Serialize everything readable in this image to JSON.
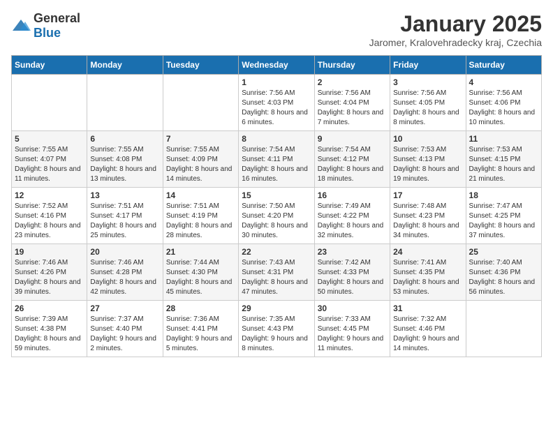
{
  "logo": {
    "general": "General",
    "blue": "Blue"
  },
  "title": "January 2025",
  "subtitle": "Jaromer, Kralovehradecky kraj, Czechia",
  "headers": [
    "Sunday",
    "Monday",
    "Tuesday",
    "Wednesday",
    "Thursday",
    "Friday",
    "Saturday"
  ],
  "weeks": [
    [
      {
        "day": "",
        "info": ""
      },
      {
        "day": "",
        "info": ""
      },
      {
        "day": "",
        "info": ""
      },
      {
        "day": "1",
        "info": "Sunrise: 7:56 AM\nSunset: 4:03 PM\nDaylight: 8 hours and 6 minutes."
      },
      {
        "day": "2",
        "info": "Sunrise: 7:56 AM\nSunset: 4:04 PM\nDaylight: 8 hours and 7 minutes."
      },
      {
        "day": "3",
        "info": "Sunrise: 7:56 AM\nSunset: 4:05 PM\nDaylight: 8 hours and 8 minutes."
      },
      {
        "day": "4",
        "info": "Sunrise: 7:56 AM\nSunset: 4:06 PM\nDaylight: 8 hours and 10 minutes."
      }
    ],
    [
      {
        "day": "5",
        "info": "Sunrise: 7:55 AM\nSunset: 4:07 PM\nDaylight: 8 hours and 11 minutes."
      },
      {
        "day": "6",
        "info": "Sunrise: 7:55 AM\nSunset: 4:08 PM\nDaylight: 8 hours and 13 minutes."
      },
      {
        "day": "7",
        "info": "Sunrise: 7:55 AM\nSunset: 4:09 PM\nDaylight: 8 hours and 14 minutes."
      },
      {
        "day": "8",
        "info": "Sunrise: 7:54 AM\nSunset: 4:11 PM\nDaylight: 8 hours and 16 minutes."
      },
      {
        "day": "9",
        "info": "Sunrise: 7:54 AM\nSunset: 4:12 PM\nDaylight: 8 hours and 18 minutes."
      },
      {
        "day": "10",
        "info": "Sunrise: 7:53 AM\nSunset: 4:13 PM\nDaylight: 8 hours and 19 minutes."
      },
      {
        "day": "11",
        "info": "Sunrise: 7:53 AM\nSunset: 4:15 PM\nDaylight: 8 hours and 21 minutes."
      }
    ],
    [
      {
        "day": "12",
        "info": "Sunrise: 7:52 AM\nSunset: 4:16 PM\nDaylight: 8 hours and 23 minutes."
      },
      {
        "day": "13",
        "info": "Sunrise: 7:51 AM\nSunset: 4:17 PM\nDaylight: 8 hours and 25 minutes."
      },
      {
        "day": "14",
        "info": "Sunrise: 7:51 AM\nSunset: 4:19 PM\nDaylight: 8 hours and 28 minutes."
      },
      {
        "day": "15",
        "info": "Sunrise: 7:50 AM\nSunset: 4:20 PM\nDaylight: 8 hours and 30 minutes."
      },
      {
        "day": "16",
        "info": "Sunrise: 7:49 AM\nSunset: 4:22 PM\nDaylight: 8 hours and 32 minutes."
      },
      {
        "day": "17",
        "info": "Sunrise: 7:48 AM\nSunset: 4:23 PM\nDaylight: 8 hours and 34 minutes."
      },
      {
        "day": "18",
        "info": "Sunrise: 7:47 AM\nSunset: 4:25 PM\nDaylight: 8 hours and 37 minutes."
      }
    ],
    [
      {
        "day": "19",
        "info": "Sunrise: 7:46 AM\nSunset: 4:26 PM\nDaylight: 8 hours and 39 minutes."
      },
      {
        "day": "20",
        "info": "Sunrise: 7:46 AM\nSunset: 4:28 PM\nDaylight: 8 hours and 42 minutes."
      },
      {
        "day": "21",
        "info": "Sunrise: 7:44 AM\nSunset: 4:30 PM\nDaylight: 8 hours and 45 minutes."
      },
      {
        "day": "22",
        "info": "Sunrise: 7:43 AM\nSunset: 4:31 PM\nDaylight: 8 hours and 47 minutes."
      },
      {
        "day": "23",
        "info": "Sunrise: 7:42 AM\nSunset: 4:33 PM\nDaylight: 8 hours and 50 minutes."
      },
      {
        "day": "24",
        "info": "Sunrise: 7:41 AM\nSunset: 4:35 PM\nDaylight: 8 hours and 53 minutes."
      },
      {
        "day": "25",
        "info": "Sunrise: 7:40 AM\nSunset: 4:36 PM\nDaylight: 8 hours and 56 minutes."
      }
    ],
    [
      {
        "day": "26",
        "info": "Sunrise: 7:39 AM\nSunset: 4:38 PM\nDaylight: 8 hours and 59 minutes."
      },
      {
        "day": "27",
        "info": "Sunrise: 7:37 AM\nSunset: 4:40 PM\nDaylight: 9 hours and 2 minutes."
      },
      {
        "day": "28",
        "info": "Sunrise: 7:36 AM\nSunset: 4:41 PM\nDaylight: 9 hours and 5 minutes."
      },
      {
        "day": "29",
        "info": "Sunrise: 7:35 AM\nSunset: 4:43 PM\nDaylight: 9 hours and 8 minutes."
      },
      {
        "day": "30",
        "info": "Sunrise: 7:33 AM\nSunset: 4:45 PM\nDaylight: 9 hours and 11 minutes."
      },
      {
        "day": "31",
        "info": "Sunrise: 7:32 AM\nSunset: 4:46 PM\nDaylight: 9 hours and 14 minutes."
      },
      {
        "day": "",
        "info": ""
      }
    ]
  ]
}
